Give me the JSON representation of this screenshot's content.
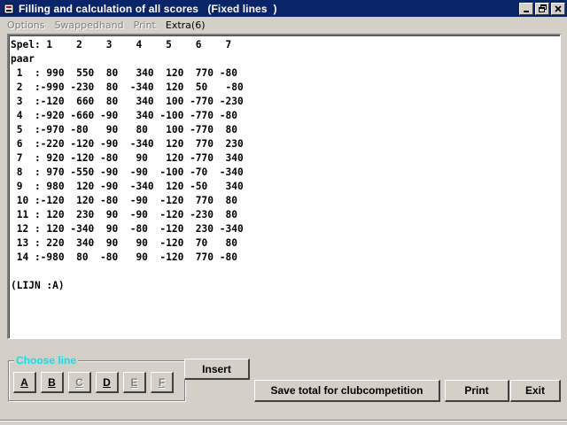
{
  "window": {
    "title": "Filling and calculation of all scores   (Fixed lines  )",
    "controls": {
      "minimize_label": "_",
      "restore_label": "❐",
      "close_label": "✕"
    }
  },
  "menu": {
    "items": [
      {
        "label": "Options",
        "enabled": false
      },
      {
        "label": "Swappedhand",
        "enabled": false
      },
      {
        "label": "Print",
        "enabled": false
      },
      {
        "label": "Extra(6)",
        "enabled": true
      }
    ]
  },
  "output": {
    "text": "Spel: 1    2    3    4    5    6    7\npaar\n 1  : 990  550  80   340  120  770 -80\n 2  :-990 -230  80  -340  120  50   -80\n 3  :-120  660  80   340  100 -770 -230\n 4  :-920 -660 -90   340 -100 -770 -80\n 5  :-970 -80   90   80   100 -770  80\n 6  :-220 -120 -90  -340  120  770  230\n 7  : 920 -120 -80   90   120 -770  340\n 8  : 970 -550 -90  -90  -100 -70  -340\n 9  : 980  120 -90  -340  120 -50   340\n 10 :-120  120 -80  -90  -120  770  80\n 11 : 120  230  90  -90  -120 -230  80\n 12 : 120 -340  90  -80  -120  230 -340\n 13 : 220  340  90   90  -120  70   80\n 14 :-980  80  -80   90  -120  770 -80\n\n(LIJN :A)"
  },
  "choose_line": {
    "legend": "Choose line",
    "buttons": [
      {
        "label": "A",
        "enabled": true
      },
      {
        "label": "B",
        "enabled": true
      },
      {
        "label": "C",
        "enabled": false
      },
      {
        "label": "D",
        "enabled": true
      },
      {
        "label": "E",
        "enabled": false
      },
      {
        "label": "F",
        "enabled": false
      }
    ]
  },
  "actions": {
    "insert_label": "Insert",
    "save_label": "Save total for clubcompetition",
    "print_label": "Print",
    "exit_label": "Exit"
  },
  "colors": {
    "titlebar": "#0a246a",
    "legend": "#00e5ee",
    "face": "#d4d0c8"
  }
}
